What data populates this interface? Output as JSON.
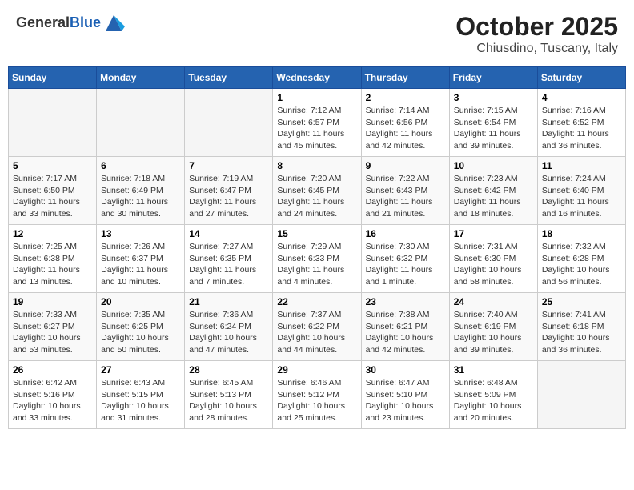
{
  "header": {
    "logo_general": "General",
    "logo_blue": "Blue",
    "month_title": "October 2025",
    "location": "Chiusdino, Tuscany, Italy"
  },
  "weekdays": [
    "Sunday",
    "Monday",
    "Tuesday",
    "Wednesday",
    "Thursday",
    "Friday",
    "Saturday"
  ],
  "rows": [
    [
      {
        "day": "",
        "info": ""
      },
      {
        "day": "",
        "info": ""
      },
      {
        "day": "",
        "info": ""
      },
      {
        "day": "1",
        "info": "Sunrise: 7:12 AM\nSunset: 6:57 PM\nDaylight: 11 hours and 45 minutes."
      },
      {
        "day": "2",
        "info": "Sunrise: 7:14 AM\nSunset: 6:56 PM\nDaylight: 11 hours and 42 minutes."
      },
      {
        "day": "3",
        "info": "Sunrise: 7:15 AM\nSunset: 6:54 PM\nDaylight: 11 hours and 39 minutes."
      },
      {
        "day": "4",
        "info": "Sunrise: 7:16 AM\nSunset: 6:52 PM\nDaylight: 11 hours and 36 minutes."
      }
    ],
    [
      {
        "day": "5",
        "info": "Sunrise: 7:17 AM\nSunset: 6:50 PM\nDaylight: 11 hours and 33 minutes."
      },
      {
        "day": "6",
        "info": "Sunrise: 7:18 AM\nSunset: 6:49 PM\nDaylight: 11 hours and 30 minutes."
      },
      {
        "day": "7",
        "info": "Sunrise: 7:19 AM\nSunset: 6:47 PM\nDaylight: 11 hours and 27 minutes."
      },
      {
        "day": "8",
        "info": "Sunrise: 7:20 AM\nSunset: 6:45 PM\nDaylight: 11 hours and 24 minutes."
      },
      {
        "day": "9",
        "info": "Sunrise: 7:22 AM\nSunset: 6:43 PM\nDaylight: 11 hours and 21 minutes."
      },
      {
        "day": "10",
        "info": "Sunrise: 7:23 AM\nSunset: 6:42 PM\nDaylight: 11 hours and 18 minutes."
      },
      {
        "day": "11",
        "info": "Sunrise: 7:24 AM\nSunset: 6:40 PM\nDaylight: 11 hours and 16 minutes."
      }
    ],
    [
      {
        "day": "12",
        "info": "Sunrise: 7:25 AM\nSunset: 6:38 PM\nDaylight: 11 hours and 13 minutes."
      },
      {
        "day": "13",
        "info": "Sunrise: 7:26 AM\nSunset: 6:37 PM\nDaylight: 11 hours and 10 minutes."
      },
      {
        "day": "14",
        "info": "Sunrise: 7:27 AM\nSunset: 6:35 PM\nDaylight: 11 hours and 7 minutes."
      },
      {
        "day": "15",
        "info": "Sunrise: 7:29 AM\nSunset: 6:33 PM\nDaylight: 11 hours and 4 minutes."
      },
      {
        "day": "16",
        "info": "Sunrise: 7:30 AM\nSunset: 6:32 PM\nDaylight: 11 hours and 1 minute."
      },
      {
        "day": "17",
        "info": "Sunrise: 7:31 AM\nSunset: 6:30 PM\nDaylight: 10 hours and 58 minutes."
      },
      {
        "day": "18",
        "info": "Sunrise: 7:32 AM\nSunset: 6:28 PM\nDaylight: 10 hours and 56 minutes."
      }
    ],
    [
      {
        "day": "19",
        "info": "Sunrise: 7:33 AM\nSunset: 6:27 PM\nDaylight: 10 hours and 53 minutes."
      },
      {
        "day": "20",
        "info": "Sunrise: 7:35 AM\nSunset: 6:25 PM\nDaylight: 10 hours and 50 minutes."
      },
      {
        "day": "21",
        "info": "Sunrise: 7:36 AM\nSunset: 6:24 PM\nDaylight: 10 hours and 47 minutes."
      },
      {
        "day": "22",
        "info": "Sunrise: 7:37 AM\nSunset: 6:22 PM\nDaylight: 10 hours and 44 minutes."
      },
      {
        "day": "23",
        "info": "Sunrise: 7:38 AM\nSunset: 6:21 PM\nDaylight: 10 hours and 42 minutes."
      },
      {
        "day": "24",
        "info": "Sunrise: 7:40 AM\nSunset: 6:19 PM\nDaylight: 10 hours and 39 minutes."
      },
      {
        "day": "25",
        "info": "Sunrise: 7:41 AM\nSunset: 6:18 PM\nDaylight: 10 hours and 36 minutes."
      }
    ],
    [
      {
        "day": "26",
        "info": "Sunrise: 6:42 AM\nSunset: 5:16 PM\nDaylight: 10 hours and 33 minutes."
      },
      {
        "day": "27",
        "info": "Sunrise: 6:43 AM\nSunset: 5:15 PM\nDaylight: 10 hours and 31 minutes."
      },
      {
        "day": "28",
        "info": "Sunrise: 6:45 AM\nSunset: 5:13 PM\nDaylight: 10 hours and 28 minutes."
      },
      {
        "day": "29",
        "info": "Sunrise: 6:46 AM\nSunset: 5:12 PM\nDaylight: 10 hours and 25 minutes."
      },
      {
        "day": "30",
        "info": "Sunrise: 6:47 AM\nSunset: 5:10 PM\nDaylight: 10 hours and 23 minutes."
      },
      {
        "day": "31",
        "info": "Sunrise: 6:48 AM\nSunset: 5:09 PM\nDaylight: 10 hours and 20 minutes."
      },
      {
        "day": "",
        "info": ""
      }
    ]
  ]
}
